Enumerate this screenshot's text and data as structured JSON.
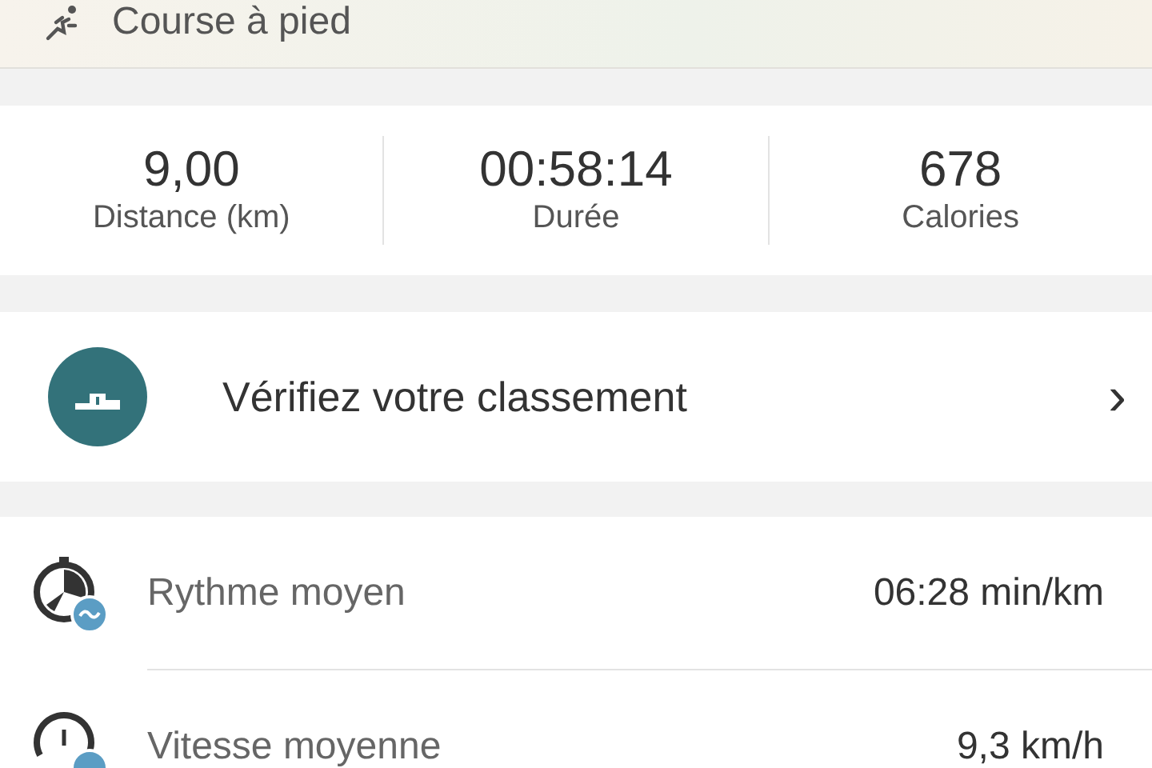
{
  "activity": {
    "label": "Course à pied"
  },
  "stats": [
    {
      "value": "9,00",
      "label": "Distance (km)"
    },
    {
      "value": "00:58:14",
      "label": "Durée"
    },
    {
      "value": "678",
      "label": "Calories"
    }
  ],
  "ranking": {
    "label": "Vérifiez votre classement",
    "chevron": "›"
  },
  "metrics": [
    {
      "kind": "pace",
      "label": "Rythme moyen",
      "value": "06:28 min/km"
    },
    {
      "kind": "speed",
      "label": "Vitesse moyenne",
      "value": "9,3 km/h"
    }
  ]
}
